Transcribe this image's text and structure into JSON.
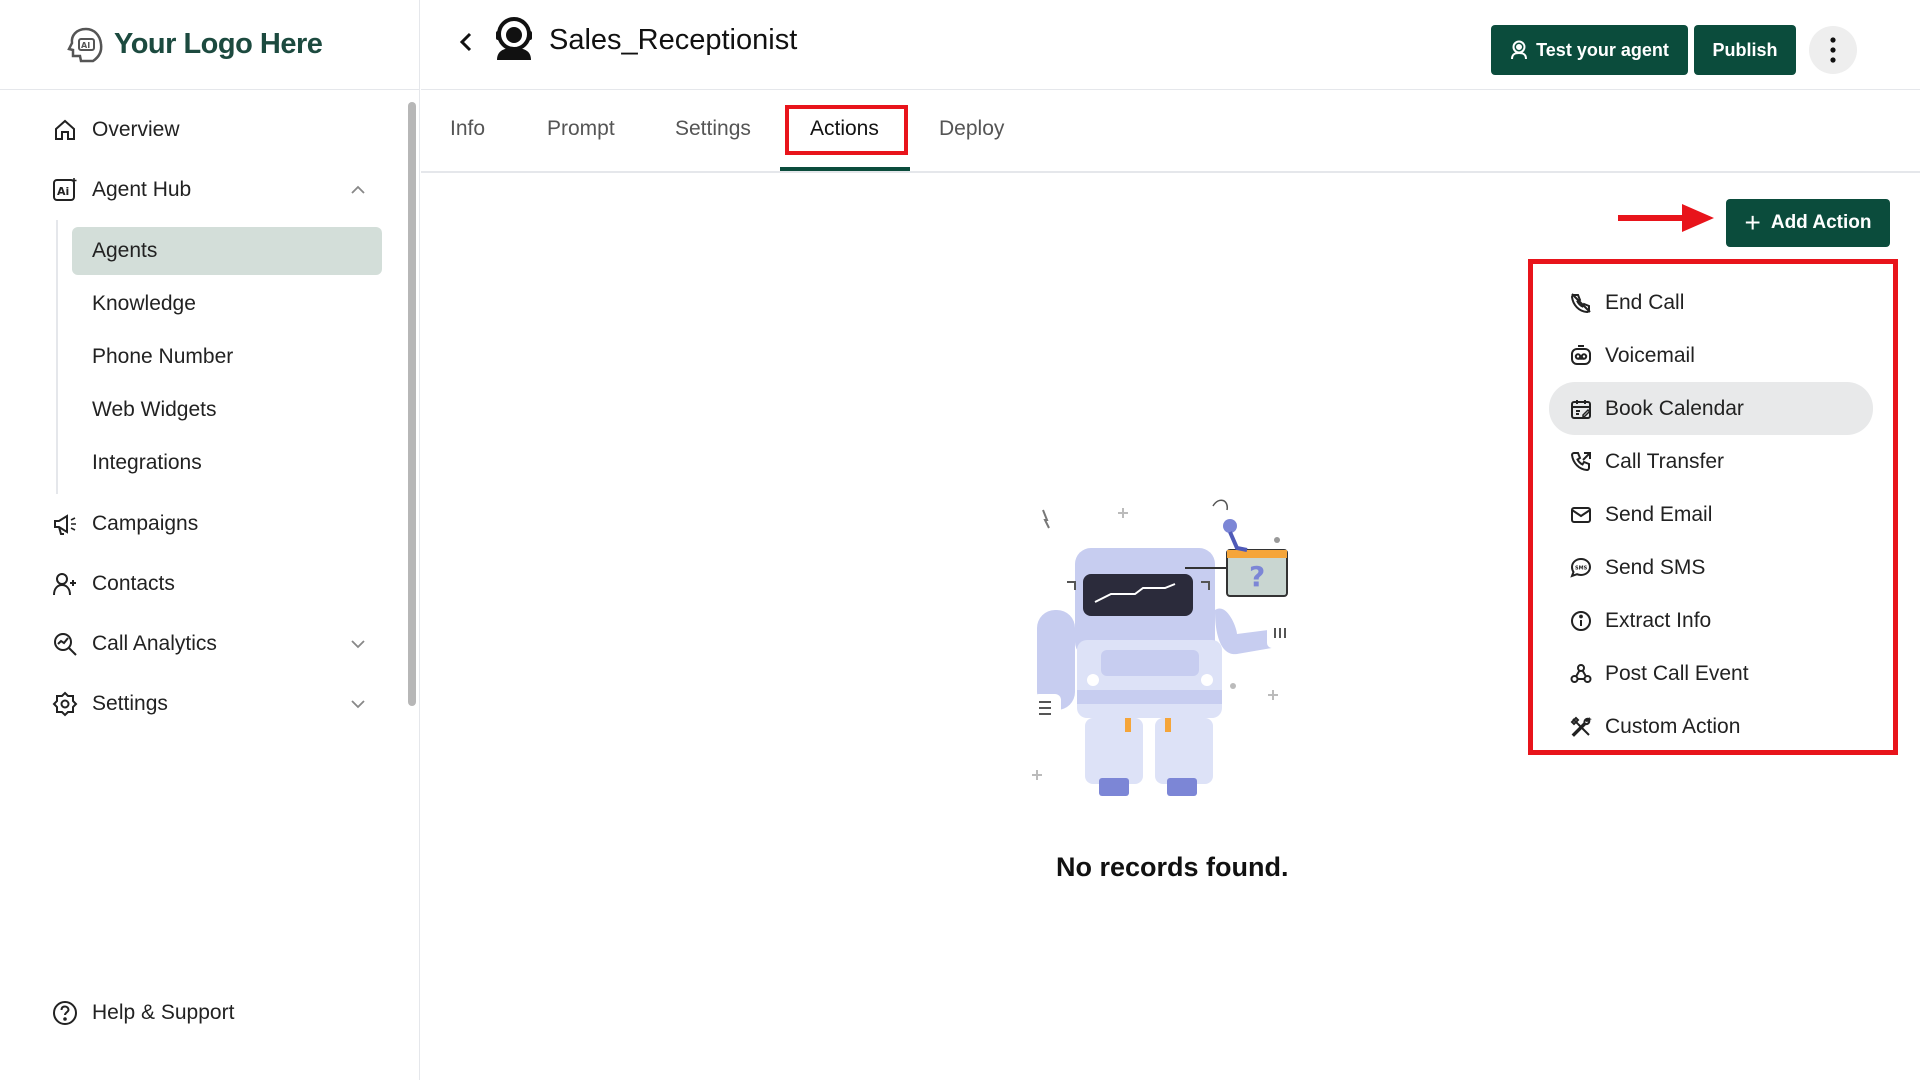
{
  "logo": {
    "text": "Your Logo Here"
  },
  "sidebar": {
    "items": [
      {
        "label": "Overview",
        "icon": "home-icon"
      },
      {
        "label": "Agent Hub",
        "icon": "ai-icon"
      },
      {
        "label": "Campaigns",
        "icon": "megaphone-icon"
      },
      {
        "label": "Contacts",
        "icon": "user-plus-icon"
      },
      {
        "label": "Call Analytics",
        "icon": "analytics-icon"
      },
      {
        "label": "Settings",
        "icon": "settings-icon"
      }
    ],
    "agent_hub_sub": [
      {
        "label": "Agents",
        "active": true
      },
      {
        "label": "Knowledge"
      },
      {
        "label": "Phone Number"
      },
      {
        "label": "Web Widgets"
      },
      {
        "label": "Integrations"
      }
    ],
    "help": "Help & Support"
  },
  "header": {
    "title": "Sales_Receptionist",
    "test_label": "Test your agent",
    "publish_label": "Publish"
  },
  "tabs": [
    {
      "label": "Info"
    },
    {
      "label": "Prompt"
    },
    {
      "label": "Settings"
    },
    {
      "label": "Actions",
      "active": true
    },
    {
      "label": "Deploy"
    }
  ],
  "actions": {
    "add_label": "Add Action",
    "menu": [
      {
        "label": "End Call",
        "icon": "end-call-icon"
      },
      {
        "label": "Voicemail",
        "icon": "voicemail-icon"
      },
      {
        "label": "Book Calendar",
        "icon": "calendar-icon",
        "hover": true
      },
      {
        "label": "Call Transfer",
        "icon": "call-transfer-icon"
      },
      {
        "label": "Send Email",
        "icon": "email-icon"
      },
      {
        "label": "Send SMS",
        "icon": "sms-icon"
      },
      {
        "label": "Extract Info",
        "icon": "info-icon"
      },
      {
        "label": "Post Call Event",
        "icon": "webhook-icon"
      },
      {
        "label": "Custom Action",
        "icon": "tools-icon"
      }
    ],
    "empty_text": "No records found."
  },
  "colors": {
    "brand": "#0b4c3c",
    "highlight": "#e8141b",
    "active_bg": "#d3ded9"
  }
}
